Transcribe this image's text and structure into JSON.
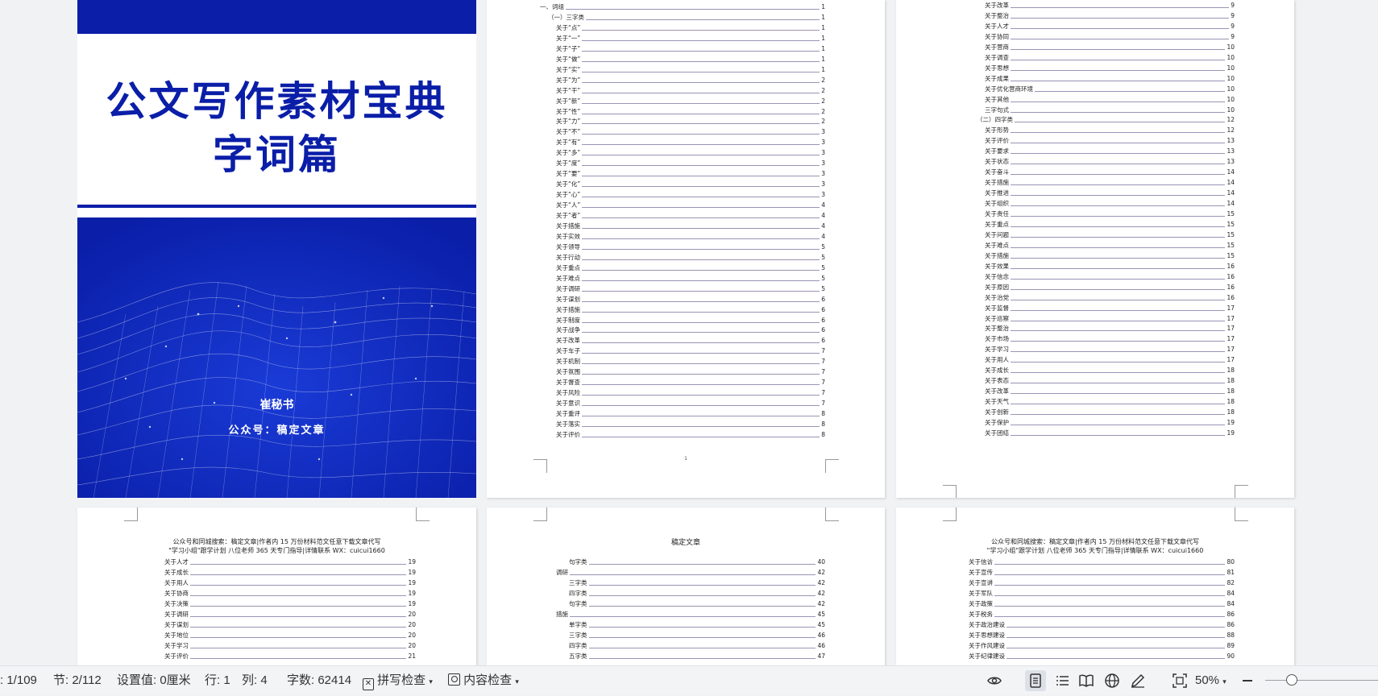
{
  "cover": {
    "title_line1": "公文写作素材宝典",
    "title_line2": "字词篇",
    "author": "崔秘书",
    "account": "公众号：稿定文章"
  },
  "page2": {
    "footer_page": "1",
    "toc": [
      [
        "一、词组",
        "1"
      ],
      [
        "（一）三字类",
        "1"
      ],
      [
        "关于“点”",
        "1"
      ],
      [
        "关于“一”",
        "1"
      ],
      [
        "关于“子”",
        "1"
      ],
      [
        "关于“做”",
        "1"
      ],
      [
        "关于“实”",
        "1"
      ],
      [
        "关于“为”",
        "2"
      ],
      [
        "关于“干”",
        "2"
      ],
      [
        "关于“新”",
        "2"
      ],
      [
        "关于“性”",
        "2"
      ],
      [
        "关于“力”",
        "2"
      ],
      [
        "关于“不”",
        "3"
      ],
      [
        "关于“有”",
        "3"
      ],
      [
        "关于“多”",
        "3"
      ],
      [
        "关于“度”",
        "3"
      ],
      [
        "关于“要”",
        "3"
      ],
      [
        "关于“化”",
        "3"
      ],
      [
        "关于“心”",
        "3"
      ],
      [
        "关于“人”",
        "4"
      ],
      [
        "关于“者”",
        "4"
      ],
      [
        "关于措施",
        "4"
      ],
      [
        "关于实效",
        "4"
      ],
      [
        "关于领导",
        "5"
      ],
      [
        "关于行动",
        "5"
      ],
      [
        "关于重点",
        "5"
      ],
      [
        "关于难点",
        "5"
      ],
      [
        "关于调研",
        "5"
      ],
      [
        "关于谋划",
        "6"
      ],
      [
        "关于措施",
        "6"
      ],
      [
        "关于制度",
        "6"
      ],
      [
        "关于战争",
        "6"
      ],
      [
        "关于改革",
        "6"
      ],
      [
        "关于车子",
        "7"
      ],
      [
        "关于机制",
        "7"
      ],
      [
        "关于氛围",
        "7"
      ],
      [
        "关于督查",
        "7"
      ],
      [
        "关于风险",
        "7"
      ],
      [
        "关于意识",
        "7"
      ],
      [
        "关于重评",
        "8"
      ],
      [
        "关于落实",
        "8"
      ],
      [
        "关于评价",
        "8"
      ]
    ]
  },
  "page3": {
    "toc": [
      [
        "关于改革",
        "9"
      ],
      [
        "关于整治",
        "9"
      ],
      [
        "关于人才",
        "9"
      ],
      [
        "关于协同",
        "9"
      ],
      [
        "关于营商",
        "10"
      ],
      [
        "关于调查",
        "10"
      ],
      [
        "关于思想",
        "10"
      ],
      [
        "关于成果",
        "10"
      ],
      [
        "关于优化营商环境",
        "10"
      ],
      [
        "关于其他",
        "10"
      ],
      [
        "三字句式",
        "10"
      ],
      [
        "（二）四字类",
        "12"
      ],
      [
        "关于形势",
        "12"
      ],
      [
        "关于评价",
        "13"
      ],
      [
        "关于要求",
        "13"
      ],
      [
        "关于状态",
        "13"
      ],
      [
        "关于奋斗",
        "14"
      ],
      [
        "关于措施",
        "14"
      ],
      [
        "关于推进",
        "14"
      ],
      [
        "关于组织",
        "14"
      ],
      [
        "关于责任",
        "15"
      ],
      [
        "关于重点",
        "15"
      ],
      [
        "关于问题",
        "15"
      ],
      [
        "关于难点",
        "15"
      ],
      [
        "关于措施",
        "15"
      ],
      [
        "关于效果",
        "16"
      ],
      [
        "关于信念",
        "16"
      ],
      [
        "关于原因",
        "16"
      ],
      [
        "关于治党",
        "16"
      ],
      [
        "关于监督",
        "17"
      ],
      [
        "关于巡察",
        "17"
      ],
      [
        "关于整治",
        "17"
      ],
      [
        "关于市场",
        "17"
      ],
      [
        "关于学习",
        "17"
      ],
      [
        "关于用人",
        "17"
      ],
      [
        "关于成长",
        "18"
      ],
      [
        "关于表态",
        "18"
      ],
      [
        "关于改革",
        "18"
      ],
      [
        "关于天气",
        "18"
      ],
      [
        "关于创新",
        "18"
      ],
      [
        "关于保护",
        "19"
      ],
      [
        "关于团结",
        "19"
      ]
    ]
  },
  "page4": {
    "header_line1": "公众号和同城搜索：稿定文章|作者内 15 万份材料范文任意下载文章代写",
    "header_line2": "\"学习小组\"跟学计划 八位老师 365 天专门指导|详情联系 WX：cuicui1660",
    "toc": [
      [
        "关于人才",
        "19"
      ],
      [
        "关于成长",
        "19"
      ],
      [
        "关于用人",
        "19"
      ],
      [
        "关于协商",
        "19"
      ],
      [
        "关于决策",
        "19"
      ],
      [
        "关于调研",
        "20"
      ],
      [
        "关于谋划",
        "20"
      ],
      [
        "关于地位",
        "20"
      ],
      [
        "关于学习",
        "20"
      ],
      [
        "关于评价",
        "21"
      ]
    ]
  },
  "page5": {
    "header": "稿定文章",
    "toc": [
      [
        "句字类",
        "40"
      ],
      [
        "调研",
        "42"
      ],
      [
        "三字类",
        "42"
      ],
      [
        "四字类",
        "42"
      ],
      [
        "句字类",
        "42"
      ],
      [
        "措施",
        "45"
      ],
      [
        "单字类",
        "45"
      ],
      [
        "三字类",
        "46"
      ],
      [
        "四字类",
        "46"
      ],
      [
        "五字类",
        "47"
      ]
    ]
  },
  "page6": {
    "header_line1": "公众号和同城搜索：稿定文章|作者内 15 万份材料范文任意下载文章代写",
    "header_line2": "\"学习小组\"跟学计划 八位老师 365 天专门指导|详情联系 WX：cuicui1660",
    "toc": [
      [
        "关于信访",
        "80"
      ],
      [
        "关于宣传",
        "81"
      ],
      [
        "关于宣讲",
        "82"
      ],
      [
        "关于军队",
        "84"
      ],
      [
        "关于政策",
        "84"
      ],
      [
        "关于税务",
        "86"
      ],
      [
        "关于政治建设",
        "86"
      ],
      [
        "关于思想建设",
        "88"
      ],
      [
        "关于作风建设",
        "89"
      ],
      [
        "关于纪律建设",
        "90"
      ]
    ]
  },
  "statusbar": {
    "page": "1/109",
    "section": "节: 2/112",
    "setting": "设置值: 0厘米",
    "row": "行: 1",
    "col": "列: 4",
    "words": "字数: 62414",
    "spell_check": "拼写检查",
    "content_check": "内容检查",
    "zoom": "50%"
  }
}
